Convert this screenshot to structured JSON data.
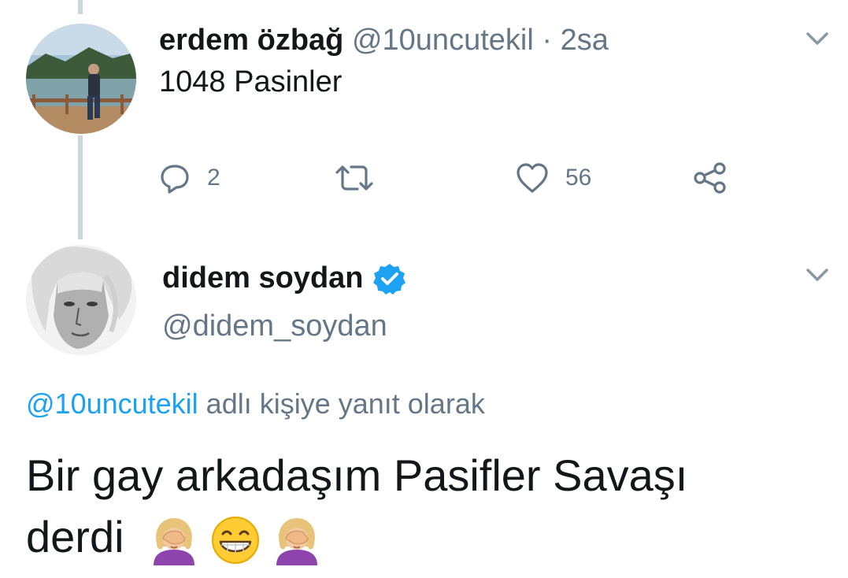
{
  "tweet": {
    "author_name": "erdem özbağ",
    "handle": "@10uncutekil",
    "separator": "·",
    "time": "2sa",
    "text": "1048 Pasinler",
    "actions": {
      "reply_count": "2",
      "like_count": "56"
    }
  },
  "reply": {
    "author_name": "didem soydan",
    "handle": "@didem_soydan",
    "reply_to_handle": "@10uncutekil",
    "reply_to_suffix": " adlı kişiye yanıt olarak",
    "text_line1": "Bir gay arkadaşım Pasifler Savaşı",
    "text_line2": "derdi"
  },
  "icons": [
    "chevron-down-icon",
    "reply-icon",
    "retweet-icon",
    "like-icon",
    "share-icon",
    "verified-badge-icon",
    "facepalm-emoji",
    "grinning-emoji"
  ],
  "colors": {
    "accent": "#1da1f2",
    "muted": "#657786",
    "text": "#14171a",
    "thread_line": "#ccd6dd"
  }
}
